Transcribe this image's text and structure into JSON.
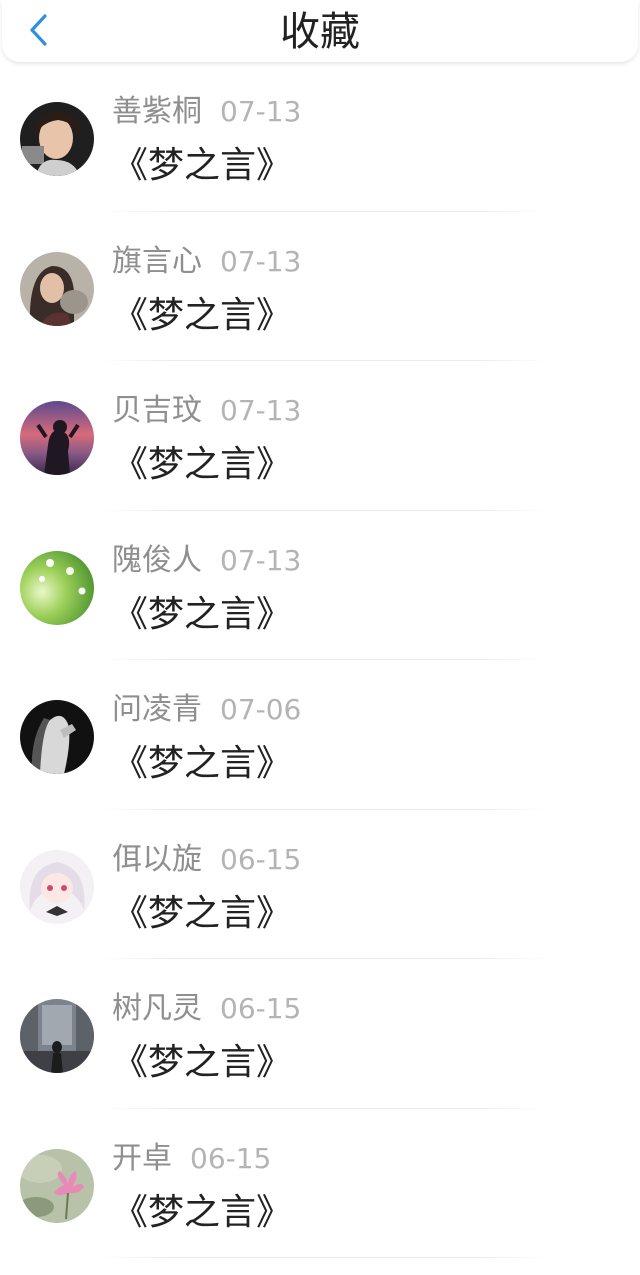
{
  "header": {
    "title": "收藏",
    "back_icon": "chevron-left-icon",
    "accent_color": "#2f8fe0"
  },
  "favorites": [
    {
      "name": "善紫桐",
      "date": "07-13",
      "title": "《梦之言》"
    },
    {
      "name": "旗言心",
      "date": "07-13",
      "title": "《梦之言》"
    },
    {
      "name": "贝吉玟",
      "date": "07-13",
      "title": "《梦之言》"
    },
    {
      "name": "隗俊人",
      "date": "07-13",
      "title": "《梦之言》"
    },
    {
      "name": "问凌青",
      "date": "07-06",
      "title": "《梦之言》"
    },
    {
      "name": "佴以旋",
      "date": "06-15",
      "title": "《梦之言》"
    },
    {
      "name": "树凡灵",
      "date": "06-15",
      "title": "《梦之言》"
    },
    {
      "name": "开卓",
      "date": "06-15",
      "title": "《梦之言》"
    }
  ]
}
